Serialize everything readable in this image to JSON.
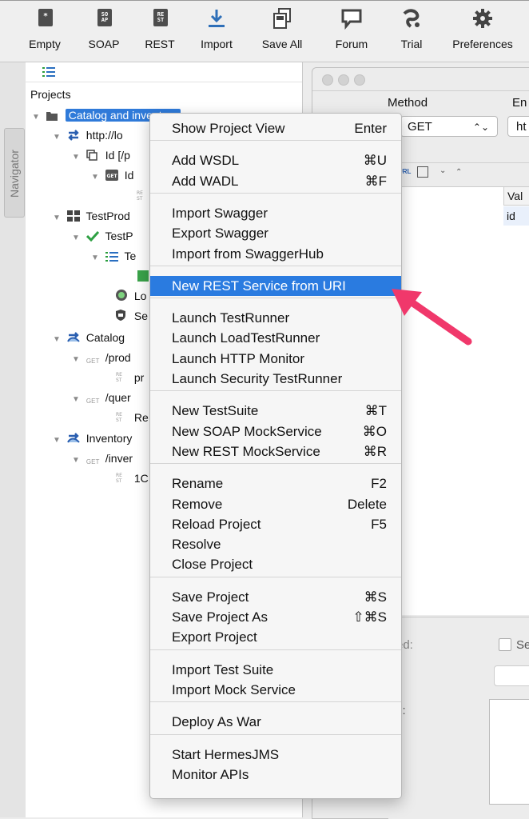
{
  "toolbar": {
    "buttons": [
      {
        "label": "Empty",
        "icon": "empty-project-icon",
        "glyph": "*"
      },
      {
        "label": "SOAP",
        "icon": "soap-icon",
        "glyph": "SO AP"
      },
      {
        "label": "REST",
        "icon": "rest-icon",
        "glyph": "RE ST"
      },
      {
        "label": "Import",
        "icon": "import-icon"
      },
      {
        "label": "Save All",
        "icon": "save-all-icon"
      },
      {
        "label": "Forum",
        "icon": "forum-icon"
      },
      {
        "label": "Trial",
        "icon": "trial-icon"
      },
      {
        "label": "Preferences",
        "icon": "gear-icon"
      }
    ]
  },
  "navigator": {
    "label": "Navigator"
  },
  "tree": {
    "root_label": "Projects",
    "nodes": [
      {
        "label": "Catalog and inventory",
        "icon": "folder-icon"
      },
      {
        "label": "http://lo",
        "icon": "rest-service-icon"
      },
      {
        "label": "Id [/p",
        "icon": "resource-icon"
      },
      {
        "label": "Id",
        "icon": "get-method-icon"
      },
      {
        "label": "",
        "icon": "rest-request-icon"
      },
      {
        "label": "TestProd",
        "icon": "testsuite-project-icon"
      },
      {
        "label": "TestP",
        "icon": "check-icon"
      },
      {
        "label": "Te",
        "icon": "testcase-icon"
      },
      {
        "label": "",
        "icon": "teststep-icon"
      },
      {
        "label": "Lo",
        "icon": "load-test-icon"
      },
      {
        "label": "Se",
        "icon": "security-test-icon"
      },
      {
        "label": "Catalog",
        "icon": "rest-service-icon"
      },
      {
        "label": "/prod",
        "icon": "get-method-icon"
      },
      {
        "label": "pr",
        "icon": "rest-request-icon"
      },
      {
        "label": "/quer",
        "icon": "get-method-icon"
      },
      {
        "label": "Re",
        "icon": "rest-request-icon"
      },
      {
        "label": "Inventory",
        "icon": "rest-service-icon"
      },
      {
        "label": "/inver",
        "icon": "get-method-icon"
      },
      {
        "label": "1C",
        "icon": "rest-request-icon"
      }
    ]
  },
  "request_panel": {
    "method_label": "Method",
    "endpoint_label": "En",
    "method_value": "GET",
    "endpoint_value": "ht",
    "param_header": "Val",
    "param_value": "id",
    "bottom_label_1": "ed:",
    "bottom_label_2": "s:",
    "checkbox_label": "Se"
  },
  "context_menu": {
    "groups": [
      [
        {
          "label": "Show Project View",
          "shortcut": "Enter"
        }
      ],
      [
        {
          "label": "Add WSDL",
          "shortcut": "⌘U"
        },
        {
          "label": "Add WADL",
          "shortcut": "⌘F"
        }
      ],
      [
        {
          "label": "Import Swagger",
          "shortcut": ""
        },
        {
          "label": "Export Swagger",
          "shortcut": ""
        },
        {
          "label": "Import from SwaggerHub",
          "shortcut": ""
        }
      ],
      [
        {
          "label": "New REST Service from URI",
          "shortcut": "",
          "highlighted": true
        }
      ],
      [
        {
          "label": "Launch TestRunner",
          "shortcut": ""
        },
        {
          "label": "Launch LoadTestRunner",
          "shortcut": ""
        },
        {
          "label": "Launch HTTP Monitor",
          "shortcut": ""
        },
        {
          "label": "Launch Security TestRunner",
          "shortcut": ""
        }
      ],
      [
        {
          "label": "New TestSuite",
          "shortcut": "⌘T"
        },
        {
          "label": "New SOAP MockService",
          "shortcut": "⌘O"
        },
        {
          "label": "New REST MockService",
          "shortcut": "⌘R"
        }
      ],
      [
        {
          "label": "Rename",
          "shortcut": "F2"
        },
        {
          "label": "Remove",
          "shortcut": "Delete"
        },
        {
          "label": "Reload Project",
          "shortcut": "F5"
        },
        {
          "label": "Resolve",
          "shortcut": ""
        },
        {
          "label": "Close Project",
          "shortcut": ""
        }
      ],
      [
        {
          "label": "Save Project",
          "shortcut": "⌘S"
        },
        {
          "label": "Save Project As",
          "shortcut": "⇧⌘S"
        },
        {
          "label": "Export Project",
          "shortcut": ""
        }
      ],
      [
        {
          "label": "Import Test Suite",
          "shortcut": ""
        },
        {
          "label": "Import Mock Service",
          "shortcut": ""
        }
      ],
      [
        {
          "label": "Deploy As War",
          "shortcut": ""
        }
      ],
      [
        {
          "label": "Start HermesJMS",
          "shortcut": ""
        },
        {
          "label": "Monitor APIs",
          "shortcut": ""
        }
      ]
    ]
  },
  "colors": {
    "highlight": "#2a7be0",
    "annotation_arrow": "#f0386b",
    "tree_selection": "#2f7ad9"
  }
}
